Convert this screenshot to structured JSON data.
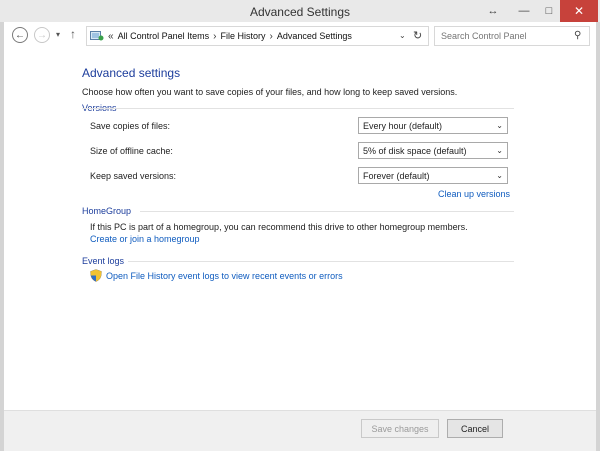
{
  "window": {
    "title": "Advanced Settings",
    "restore_glyph": "↔",
    "min_glyph": "—",
    "max_glyph": "□",
    "close_glyph": "✕"
  },
  "nav": {
    "back_icon": "arrow-left-icon",
    "forward_icon": "arrow-right-icon",
    "recent_icon": "chevron-down-icon",
    "up_icon": "arrow-up-icon",
    "back_glyph": "←",
    "forward_glyph": "→",
    "recent_glyph": "▾",
    "up_glyph": "↑",
    "breadcrumb_lead": "«",
    "breadcrumbs": [
      "All Control Panel Items",
      "File History",
      "Advanced Settings"
    ],
    "breadcrumb_sep": "›",
    "address_dropdown_glyph": "⌄",
    "refresh_glyph": "↻",
    "search_placeholder": "Search Control Panel",
    "search_glyph": "⚲"
  },
  "page": {
    "heading": "Advanced settings",
    "description": "Choose how often you want to save copies of your files, and how long to keep saved versions."
  },
  "versions": {
    "title": "Versions",
    "rows": [
      {
        "label": "Save copies of files:",
        "value": "Every hour (default)"
      },
      {
        "label": "Size of offline cache:",
        "value": "5% of disk space (default)"
      },
      {
        "label": "Keep saved versions:",
        "value": "Forever (default)"
      }
    ],
    "dropdown_glyph": "⌄",
    "cleanup_link": "Clean up versions"
  },
  "homegroup": {
    "title": "HomeGroup",
    "text": "If this PC is part of a homegroup, you can recommend this drive to other homegroup members.",
    "link": "Create or join a homegroup"
  },
  "event_logs": {
    "title": "Event logs",
    "link": "Open File History event logs to view recent events or errors"
  },
  "footer": {
    "save_label": "Save changes",
    "cancel_label": "Cancel"
  },
  "colors": {
    "heading": "#1c3d9c",
    "link": "#0f5cbf",
    "close": "#c7423b"
  }
}
